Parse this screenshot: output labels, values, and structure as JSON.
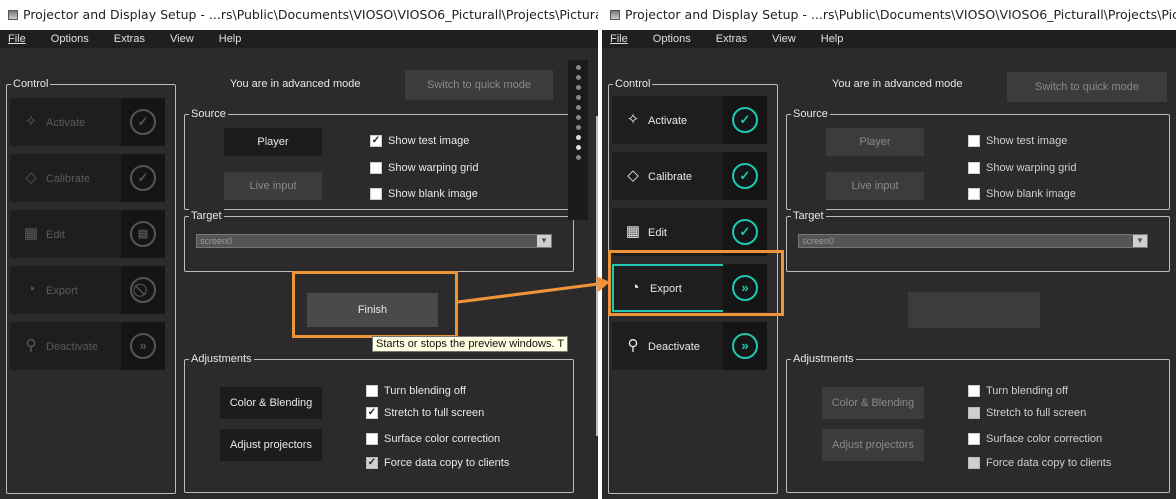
{
  "left": {
    "title": "Projector and Display Setup - ...rs\\Public\\Documents\\VIOSO\\VIOSO6_Picturall\\Projects\\Picturall",
    "menu": [
      "File",
      "Options",
      "Extras",
      "View",
      "Help"
    ],
    "control_label": "Control",
    "control_items": [
      {
        "label": "Activate",
        "icon": "sparkle-icon",
        "status": "check"
      },
      {
        "label": "Calibrate",
        "icon": "diamond-icon",
        "status": "check"
      },
      {
        "label": "Edit",
        "icon": "grid-icon",
        "status": "grid"
      },
      {
        "label": "Export",
        "icon": "export-icon",
        "status": "blocked"
      },
      {
        "label": "Deactivate",
        "icon": "bulb-icon",
        "status": "forward"
      }
    ],
    "mode_text": "You are in advanced mode",
    "switch_button": "Switch to quick mode",
    "source_label": "Source",
    "player_button": "Player",
    "live_input_button": "Live input",
    "source_checks": [
      {
        "label": "Show test image",
        "checked": true
      },
      {
        "label": "Show warping grid",
        "checked": false
      },
      {
        "label": "Show blank image",
        "checked": false
      }
    ],
    "target_label": "Target",
    "target_value": "screen0",
    "finish_button": "Finish",
    "tooltip": "Starts or stops the preview windows. T",
    "adjustments_label": "Adjustments",
    "color_blending_button": "Color & Blending",
    "adjust_projectors_button": "Adjust projectors",
    "adjust_checks": [
      {
        "label": "Turn blending off",
        "checked": false
      },
      {
        "label": "Stretch to full screen",
        "checked": true
      },
      {
        "label": "Surface color correction",
        "checked": false
      },
      {
        "label": "Force data copy to clients",
        "checked": true
      }
    ]
  },
  "right": {
    "title": "Projector and Display Setup - ...rs\\Public\\Documents\\VIOSO\\VIOSO6_Picturall\\Projects\\Pictu",
    "menu": [
      "File",
      "Options",
      "Extras",
      "View",
      "Help"
    ],
    "control_label": "Control",
    "control_items": [
      {
        "label": "Activate",
        "icon": "sparkle-icon",
        "status": "check"
      },
      {
        "label": "Calibrate",
        "icon": "diamond-icon",
        "status": "check"
      },
      {
        "label": "Edit",
        "icon": "grid-icon",
        "status": "check"
      },
      {
        "label": "Export",
        "icon": "export-icon",
        "status": "forward"
      },
      {
        "label": "Deactivate",
        "icon": "bulb-icon",
        "status": "forward"
      }
    ],
    "mode_text": "You are in advanced mode",
    "switch_button": "Switch to quick mode",
    "source_label": "Source",
    "player_button": "Player",
    "live_input_button": "Live input",
    "source_checks": [
      {
        "label": "Show test image",
        "checked": false
      },
      {
        "label": "Show warping grid",
        "checked": false
      },
      {
        "label": "Show blank image",
        "checked": false
      }
    ],
    "target_label": "Target",
    "target_value": "screen0",
    "adjustments_label": "Adjustments",
    "color_blending_button": "Color & Blending",
    "adjust_projectors_button": "Adjust projectors",
    "adjust_checks": [
      {
        "label": "Turn blending off",
        "checked": false
      },
      {
        "label": "Stretch to full screen",
        "checked": false
      },
      {
        "label": "Surface color correction",
        "checked": false
      },
      {
        "label": "Force data copy to clients",
        "checked": false
      }
    ]
  },
  "colors": {
    "accent_teal": "#20c9b0",
    "highlight_orange": "#f0943a",
    "window_bg": "#2b2b2b"
  }
}
